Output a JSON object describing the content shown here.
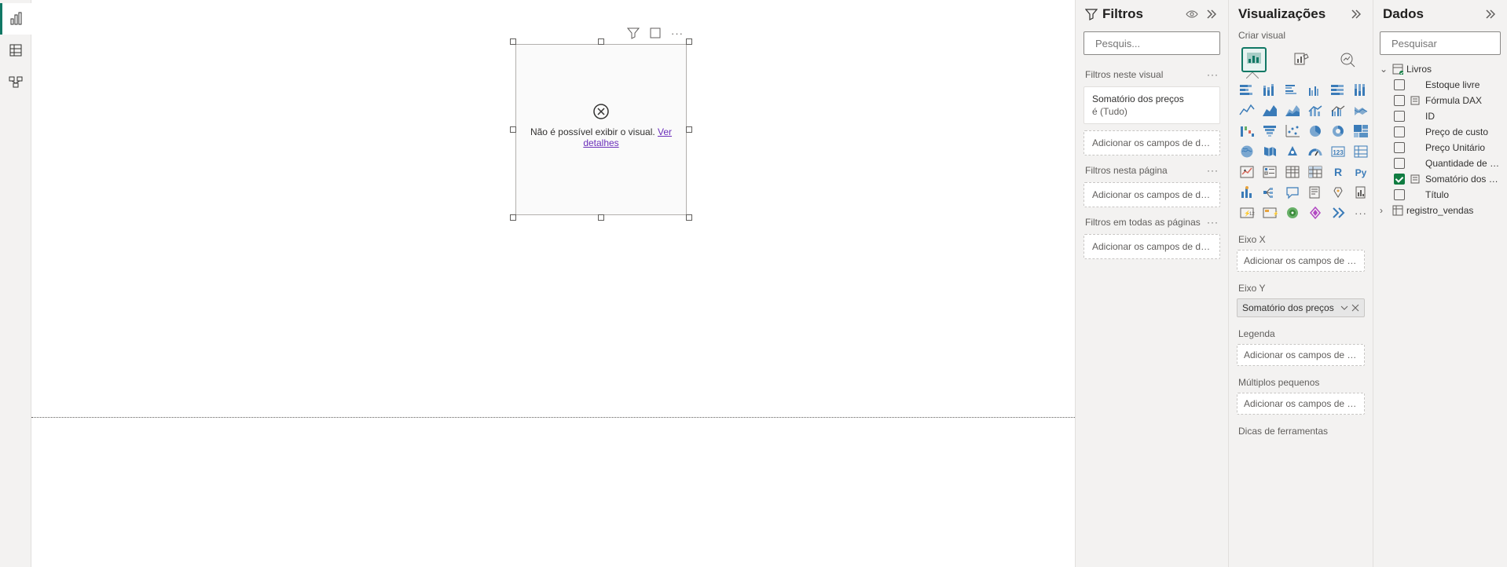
{
  "left_rail": {
    "report": "Report",
    "data": "Data",
    "model": "Model"
  },
  "canvas": {
    "error_text": "Não é possível exibir o visual. ",
    "error_link": "Ver detalhes"
  },
  "filters": {
    "title": "Filtros",
    "search_placeholder": "Pesquis...",
    "section_visual": "Filtros neste visual",
    "card1_title": "Somatório dos preços",
    "card1_sub": "é (Tudo)",
    "drop_placeholder": "Adicionar os campos de da...",
    "section_page": "Filtros nesta página",
    "section_all": "Filtros em todas as páginas"
  },
  "viz": {
    "title": "Visualizações",
    "subtitle": "Criar visual",
    "sections": {
      "x": "Eixo X",
      "y": "Eixo Y",
      "legend": "Legenda",
      "small": "Múltiplos pequenos",
      "tooltip": "Dicas de ferramentas"
    },
    "y_field": "Somatório dos preços",
    "drop_placeholder": "Adicionar os campos de da..."
  },
  "data": {
    "title": "Dados",
    "search_placeholder": "Pesquisar",
    "tables": [
      {
        "name": "Livros",
        "expanded": true,
        "fields": [
          {
            "name": "Estoque livre",
            "checked": false,
            "icon": ""
          },
          {
            "name": "Fórmula DAX",
            "checked": false,
            "icon": "measure"
          },
          {
            "name": "ID",
            "checked": false,
            "icon": ""
          },
          {
            "name": "Preço de custo",
            "checked": false,
            "icon": ""
          },
          {
            "name": "Preço Unitário",
            "checked": false,
            "icon": ""
          },
          {
            "name": "Quantidade de v...",
            "checked": false,
            "icon": ""
          },
          {
            "name": "Somatório dos p...",
            "checked": true,
            "icon": "measure"
          },
          {
            "name": "Título",
            "checked": false,
            "icon": ""
          }
        ]
      },
      {
        "name": "registro_vendas",
        "expanded": false,
        "fields": []
      }
    ]
  }
}
